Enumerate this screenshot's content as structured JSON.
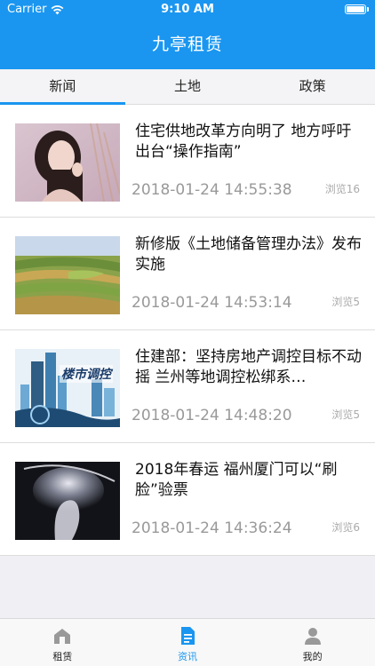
{
  "status_bar": {
    "carrier": "Carrier",
    "time": "9:10 AM"
  },
  "app_title": "九亭租赁",
  "tabs": [
    {
      "label": "新闻",
      "active": true
    },
    {
      "label": "土地",
      "active": false
    },
    {
      "label": "政策",
      "active": false
    }
  ],
  "news": [
    {
      "title": "住宅供地改革方向明了 地方呼吁出台“操作指南”",
      "date": "2018-01-24 14:55:38",
      "views": "浏览16",
      "thumb": "portrait-photo"
    },
    {
      "title": "新修版《土地储备管理办法》发布实施",
      "date": "2018-01-24 14:53:14",
      "views": "浏览5",
      "thumb": "terraced-fields-photo"
    },
    {
      "title": "住建部：坚持房地产调控目标不动摇 兰州等地调控松绑系…",
      "date": "2018-01-24 14:48:20",
      "views": "浏览5",
      "thumb": "city-skyline-photo",
      "thumb_caption": "楼市调控"
    },
    {
      "title": "2018年春运 福州厦门可以“刷脸”验票",
      "date": "2018-01-24 14:36:24",
      "views": "浏览6",
      "thumb": "face-silhouette-photo"
    }
  ],
  "tabbar": [
    {
      "label": "租赁",
      "icon": "house-icon",
      "active": false
    },
    {
      "label": "资讯",
      "icon": "document-icon",
      "active": true
    },
    {
      "label": "我的",
      "icon": "person-icon",
      "active": false
    }
  ],
  "colors": {
    "accent": "#1a96f0",
    "date_gray": "#999999"
  }
}
